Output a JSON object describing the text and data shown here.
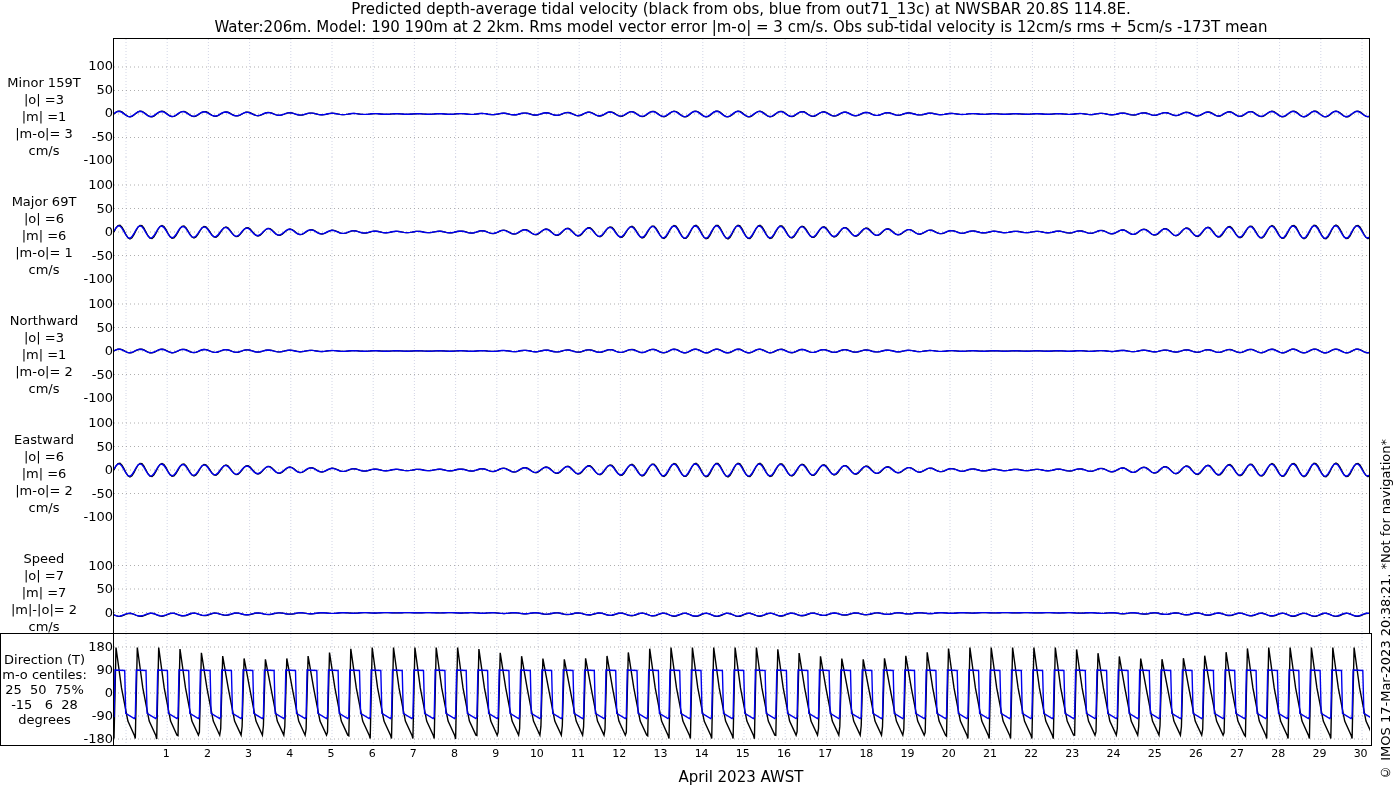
{
  "title_lines": [
    "Predicted depth-average tidal velocity (black from obs, blue from out71_13c) at NWSBAR 20.8S 114.8E.",
    "Water:206m. Model: 190 190m at 2 2km. Rms model vector error |m-o| = 3 cm/s. Obs sub-tidal velocity is 12cm/s rms + 5cm/s -173T mean"
  ],
  "panels": [
    {
      "kind": "signed",
      "label_lines": [
        "Minor 159T",
        "|o| =3",
        "|m| =1",
        "|m-o|= 3",
        "cm/s"
      ],
      "yticks": [
        "100",
        "50",
        "0",
        "-50",
        "-100"
      ]
    },
    {
      "kind": "signed",
      "label_lines": [
        "Major 69T",
        "|o| =6",
        "|m| =6",
        "|m-o|= 1",
        "cm/s"
      ],
      "yticks": [
        "100",
        "50",
        "0",
        "-50",
        "-100"
      ]
    },
    {
      "kind": "signed",
      "label_lines": [
        "Northward",
        "|o| =3",
        "|m| =1",
        "|m-o|= 2",
        "cm/s"
      ],
      "yticks": [
        "100",
        "50",
        "0",
        "-50",
        "-100"
      ]
    },
    {
      "kind": "signed",
      "label_lines": [
        "Eastward",
        "|o| =6",
        "|m| =6",
        "|m-o|= 2",
        "cm/s"
      ],
      "yticks": [
        "100",
        "50",
        "0",
        "-50",
        "-100"
      ]
    },
    {
      "kind": "magnitude",
      "label_lines": [
        "Speed",
        "|o| =7",
        "|m| =7",
        "|m|-|o|= 2",
        "cm/s"
      ],
      "yticks": [
        "100",
        "50",
        "0"
      ]
    }
  ],
  "direction_panel": {
    "label_lines": [
      "Direction (T)",
      "m-o centiles:",
      "25  50  75%",
      "-15   6  28",
      "degrees"
    ],
    "yticks": [
      "180",
      "90",
      "0",
      "-90",
      "-180"
    ]
  },
  "xticks": [
    "1",
    "2",
    "3",
    "4",
    "5",
    "6",
    "7",
    "8",
    "9",
    "10",
    "11",
    "12",
    "13",
    "14",
    "15",
    "16",
    "17",
    "18",
    "19",
    "20",
    "21",
    "22",
    "23",
    "24",
    "25",
    "26",
    "27",
    "28",
    "29",
    "30"
  ],
  "xlabel": "April 2023 AWST",
  "side_note": "© IMOS 17-Mar-2023 20:38:21. *Not for navigation*"
}
